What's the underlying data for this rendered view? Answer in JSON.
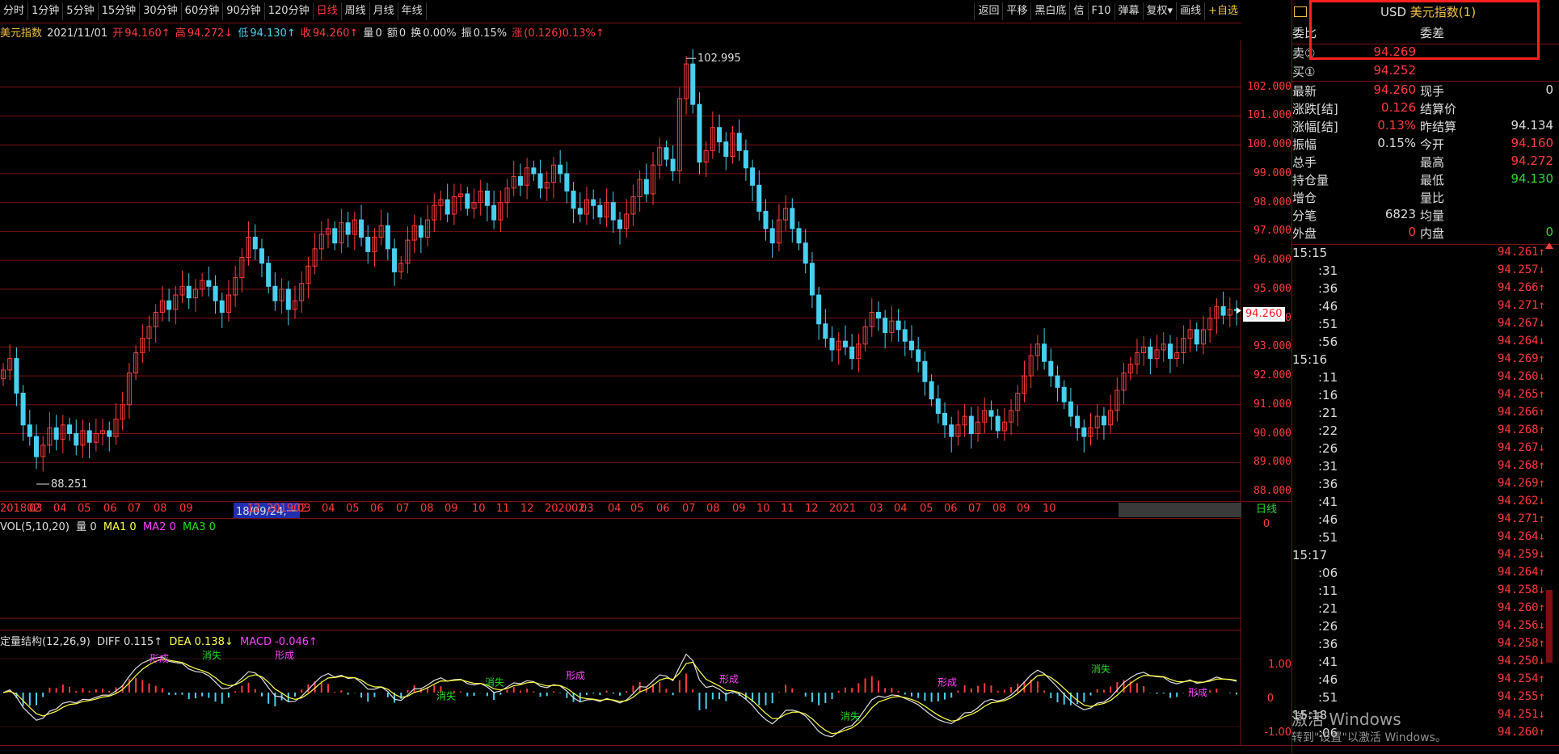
{
  "toolbar": {
    "periods": [
      "分时",
      "1分钟",
      "5分钟",
      "15分钟",
      "30分钟",
      "60分钟",
      "90分钟",
      "120分钟",
      "日线",
      "周线",
      "月线",
      "年线"
    ],
    "active_period": "日线",
    "right_tools": [
      "返回",
      "平移",
      "黑白底",
      "信",
      "F10",
      "弹幕",
      "复权▾",
      "画线",
      "+自选"
    ]
  },
  "info": {
    "name": "美元指数",
    "date": "2021/11/01",
    "open_label": "开",
    "open": "94.160↑",
    "high_label": "高",
    "high": "94.272↓",
    "low_label": "低",
    "low": "94.130↑",
    "close_label": "收",
    "close": "94.260↑",
    "vol_label": "量",
    "vol": "0",
    "amt_label": "额",
    "amt": "0",
    "turn_label": "换",
    "turn": "0.00%",
    "amp_label": "振",
    "amp": "0.15%",
    "chg_label": "涨",
    "chg": "(0.126)0.13%↑"
  },
  "chart_data": [
    {
      "type": "candlestick",
      "title": "美元指数",
      "ylim": [
        88.0,
        103.0
      ],
      "y_ticks": [
        "102.000",
        "101.000",
        "100.000",
        "99.000",
        "98.000",
        "97.000",
        "96.000",
        "95.000",
        "94.000",
        "93.000",
        "92.000",
        "91.000",
        "90.000",
        "89.000",
        "88.000"
      ],
      "x_ticks": [
        "201802",
        "03",
        "04",
        "05",
        "06",
        "07",
        "08",
        "09",
        "18/09/24,一",
        "12",
        "201902",
        "03",
        "04",
        "05",
        "06",
        "07",
        "08",
        "09",
        "10",
        "11",
        "12",
        "202002",
        "03",
        "04",
        "05",
        "06",
        "07",
        "08",
        "09",
        "10",
        "11",
        "12",
        "2021",
        "03",
        "04",
        "05",
        "06",
        "07",
        "08",
        "09",
        "10"
      ],
      "annotations": [
        {
          "text": "102.995",
          "label": "max"
        },
        {
          "text": "88.251",
          "label": "min"
        },
        {
          "text": "94.260",
          "label": "last"
        }
      ],
      "closes": [
        92.2,
        92.6,
        91.4,
        90.3,
        89.9,
        89.2,
        89.6,
        90.2,
        89.8,
        90.3,
        90.0,
        89.6,
        90.1,
        89.7,
        90.0,
        90.1,
        89.9,
        90.5,
        91.0,
        92.1,
        92.8,
        93.3,
        93.7,
        94.2,
        94.6,
        94.3,
        94.8,
        95.1,
        94.7,
        95.0,
        95.3,
        95.1,
        94.6,
        94.2,
        94.8,
        95.4,
        96.1,
        96.8,
        96.4,
        95.9,
        95.1,
        94.6,
        95.0,
        94.3,
        94.6,
        95.2,
        95.8,
        96.4,
        96.9,
        97.1,
        96.6,
        97.3,
        96.9,
        97.4,
        96.8,
        96.3,
        96.8,
        97.2,
        96.4,
        95.6,
        95.9,
        96.7,
        97.2,
        96.8,
        97.4,
        97.9,
        98.1,
        97.6,
        98.2,
        98.3,
        97.8,
        98.0,
        98.4,
        97.9,
        97.4,
        98.0,
        98.5,
        98.9,
        98.6,
        99.2,
        99.0,
        98.5,
        98.7,
        99.3,
        99.0,
        98.4,
        97.8,
        97.6,
        98.1,
        97.9,
        97.5,
        98.0,
        97.4,
        97.1,
        97.6,
        98.2,
        98.8,
        98.3,
        99.3,
        99.9,
        99.5,
        99.1,
        101.6,
        102.8,
        101.4,
        99.4,
        99.8,
        100.6,
        100.1,
        99.6,
        100.4,
        99.8,
        99.2,
        98.6,
        97.7,
        97.1,
        96.6,
        97.4,
        97.8,
        97.1,
        96.6,
        95.9,
        94.8,
        93.8,
        93.3,
        92.9,
        93.2,
        93.0,
        92.6,
        93.1,
        93.7,
        94.2,
        94.0,
        93.5,
        93.9,
        93.6,
        93.2,
        92.9,
        92.5,
        91.8,
        91.2,
        90.7,
        90.3,
        89.9,
        90.3,
        90.6,
        90.0,
        90.4,
        90.8,
        90.6,
        90.1,
        90.4,
        90.8,
        91.4,
        92.0,
        92.7,
        93.1,
        92.5,
        92.0,
        91.6,
        91.1,
        90.6,
        90.2,
        89.9,
        90.2,
        90.6,
        90.3,
        90.8,
        91.5,
        92.1,
        92.4,
        92.8,
        93.0,
        92.6,
        92.9,
        93.1,
        92.6,
        92.8,
        93.3,
        93.6,
        93.1,
        93.6,
        94.0,
        94.4,
        94.1,
        94.3,
        94.26
      ]
    },
    {
      "type": "bar",
      "title": "VOL(5,10,20)",
      "series": [
        {
          "name": "量",
          "value": "0"
        },
        {
          "name": "MA1",
          "value": "0"
        },
        {
          "name": "MA2",
          "value": "0"
        },
        {
          "name": "MA3",
          "value": "0"
        }
      ],
      "y_ticks": [
        "0"
      ]
    },
    {
      "type": "line",
      "title": "定量结构(12,26,9)",
      "series": [
        {
          "name": "DIFF",
          "value": "0.115↑"
        },
        {
          "name": "DEA",
          "value": "0.138↓"
        },
        {
          "name": "MACD",
          "value": "-0.046↑"
        }
      ],
      "y_ticks": [
        "1.00",
        "0",
        "-1.00"
      ],
      "signal_words": [
        "形成",
        "消失"
      ]
    }
  ],
  "date_axis": {
    "labels": [
      "201802",
      "03",
      "04",
      "05",
      "06",
      "07",
      "08",
      "09",
      "12",
      "201902",
      "03",
      "04",
      "05",
      "06",
      "07",
      "08",
      "09",
      "10",
      "11",
      "12",
      "202002",
      "03",
      "04",
      "05",
      "06",
      "07",
      "08",
      "09",
      "10",
      "11",
      "12",
      "2021",
      "03",
      "04",
      "05",
      "06",
      "07",
      "08",
      "09",
      "10"
    ],
    "cursor_label": "18/09/24,一",
    "period_tag": "日线"
  },
  "panel": {
    "symbol_code": "USD",
    "symbol_name": "美元指数(1)",
    "bid_ratio_label": "委比",
    "bid_diff_label": "委差",
    "sell_label": "卖①",
    "sell": "94.269",
    "buy_label": "买①",
    "buy": "94.252",
    "rows": [
      {
        "l1": "最新",
        "v1": "94.260",
        "c1": "#ff3b3b",
        "l2": "现手",
        "v2": "0",
        "c2": "#dddddd"
      },
      {
        "l1": "涨跌[结]",
        "v1": "0.126",
        "c1": "#ff3b3b",
        "l2": "结算价",
        "v2": "",
        "c2": "#dddddd"
      },
      {
        "l1": "涨幅[结]",
        "v1": "0.13%",
        "c1": "#ff3b3b",
        "l2": "昨结算",
        "v2": "94.134",
        "c2": "#dddddd"
      },
      {
        "l1": "振幅",
        "v1": "0.15%",
        "c1": "#dddddd",
        "l2": "今开",
        "v2": "94.160",
        "c2": "#ff3b3b"
      },
      {
        "l1": "总手",
        "v1": "",
        "c1": "#dddddd",
        "l2": "最高",
        "v2": "94.272",
        "c2": "#ff3b3b"
      },
      {
        "l1": "持仓量",
        "v1": "",
        "c1": "#dddddd",
        "l2": "最低",
        "v2": "94.130",
        "c2": "#22dd22"
      },
      {
        "l1": "增仓",
        "v1": "",
        "c1": "#dddddd",
        "l2": "量比",
        "v2": "",
        "c2": "#dddddd"
      },
      {
        "l1": "分笔",
        "v1": "6823",
        "c1": "#dddddd",
        "l2": "均量",
        "v2": "",
        "c2": "#dddddd"
      },
      {
        "l1": "外盘",
        "v1": "0",
        "c1": "#ff3b3b",
        "l2": "内盘",
        "v2": "0",
        "c2": "#22dd22"
      }
    ],
    "ticks": [
      {
        "t": "15:15",
        "p": "94.261↑",
        "c": "#ff3b3b"
      },
      {
        "t": ":31",
        "p": "94.257↓",
        "c": "#ff3b3b"
      },
      {
        "t": ":36",
        "p": "94.266↑",
        "c": "#ff3b3b"
      },
      {
        "t": ":46",
        "p": "94.271↑",
        "c": "#ff3b3b"
      },
      {
        "t": ":51",
        "p": "94.267↓",
        "c": "#ff3b3b"
      },
      {
        "t": ":56",
        "p": "94.264↓",
        "c": "#ff3b3b"
      },
      {
        "t": "15:16",
        "p": "94.269↑",
        "c": "#ff3b3b"
      },
      {
        "t": ":11",
        "p": "94.260↓",
        "c": "#ff3b3b"
      },
      {
        "t": ":16",
        "p": "94.265↑",
        "c": "#ff3b3b"
      },
      {
        "t": ":21",
        "p": "94.266↑",
        "c": "#ff3b3b"
      },
      {
        "t": ":22",
        "p": "94.268↑",
        "c": "#ff3b3b"
      },
      {
        "t": ":26",
        "p": "94.267↓",
        "c": "#ff3b3b"
      },
      {
        "t": ":31",
        "p": "94.268↑",
        "c": "#ff3b3b"
      },
      {
        "t": ":36",
        "p": "94.269↑",
        "c": "#ff3b3b"
      },
      {
        "t": ":41",
        "p": "94.262↓",
        "c": "#ff3b3b"
      },
      {
        "t": ":46",
        "p": "94.271↑",
        "c": "#ff3b3b"
      },
      {
        "t": ":51",
        "p": "94.264↓",
        "c": "#ff3b3b"
      },
      {
        "t": "15:17",
        "p": "94.259↓",
        "c": "#ff3b3b"
      },
      {
        "t": ":06",
        "p": "94.264↑",
        "c": "#ff3b3b"
      },
      {
        "t": ":11",
        "p": "94.258↓",
        "c": "#ff3b3b"
      },
      {
        "t": ":21",
        "p": "94.260↑",
        "c": "#ff3b3b"
      },
      {
        "t": ":26",
        "p": "94.256↓",
        "c": "#ff3b3b"
      },
      {
        "t": ":36",
        "p": "94.258↑",
        "c": "#ff3b3b"
      },
      {
        "t": ":41",
        "p": "94.250↓",
        "c": "#ff3b3b"
      },
      {
        "t": ":46",
        "p": "94.254↑",
        "c": "#ff3b3b"
      },
      {
        "t": ":51",
        "p": "94.255↑",
        "c": "#ff3b3b"
      },
      {
        "t": "15:18",
        "p": "94.251↓",
        "c": "#ff3b3b"
      },
      {
        "t": ":06",
        "p": "94.260↑",
        "c": "#ff3b3b"
      }
    ]
  },
  "watermark": {
    "line1": "激活 Windows",
    "line2": "转到\"设置\"以激活 Windows。"
  },
  "colors": {
    "up": "#ff3b3b",
    "down": "#49d0f0",
    "grid": "#7a1010",
    "accent": "#f0c040"
  }
}
